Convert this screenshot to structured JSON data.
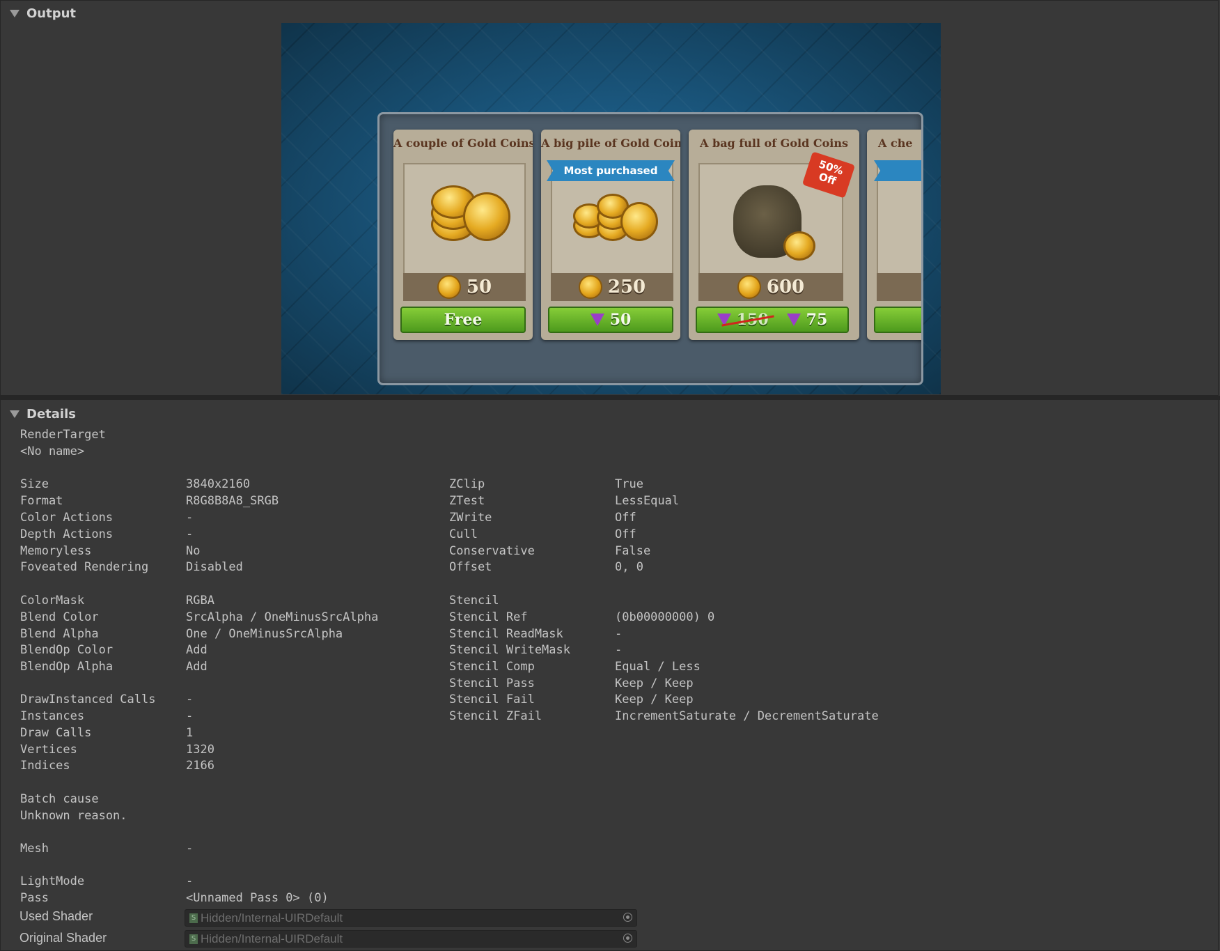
{
  "output_panel": {
    "title": "Output"
  },
  "preview": {
    "cards": [
      {
        "title": "A couple of Gold Coins",
        "amount": "50",
        "button": "Free"
      },
      {
        "title": "A big pile of Gold Coins",
        "ribbon": "Most purchased",
        "amount": "250",
        "button_price": "50"
      },
      {
        "title": "A bag full of Gold Coins",
        "tag": "50% Off",
        "amount": "600",
        "old_price": "150",
        "button_price": "75"
      },
      {
        "title": "A che"
      }
    ]
  },
  "details_panel": {
    "title": "Details",
    "render_target_label": "RenderTarget",
    "render_target_name": "<No name>",
    "left": [
      {
        "label": "Size",
        "value": "3840x2160"
      },
      {
        "label": "Format",
        "value": "R8G8B8A8_SRGB"
      },
      {
        "label": "Color Actions",
        "value": "-"
      },
      {
        "label": "Depth Actions",
        "value": "-"
      },
      {
        "label": "Memoryless",
        "value": "No"
      },
      {
        "label": "Foveated Rendering",
        "value": "Disabled"
      },
      {
        "label": "ColorMask",
        "value": "RGBA"
      },
      {
        "label": "Blend Color",
        "value": "SrcAlpha / OneMinusSrcAlpha"
      },
      {
        "label": "Blend Alpha",
        "value": "One / OneMinusSrcAlpha"
      },
      {
        "label": "BlendOp Color",
        "value": "Add"
      },
      {
        "label": "BlendOp Alpha",
        "value": "Add"
      },
      {
        "label": "DrawInstanced Calls",
        "value": "-"
      },
      {
        "label": "Instances",
        "value": "-"
      },
      {
        "label": "Draw Calls",
        "value": "1"
      },
      {
        "label": "Vertices",
        "value": "1320"
      },
      {
        "label": "Indices",
        "value": "2166"
      }
    ],
    "right": [
      {
        "label": "ZClip",
        "value": "True"
      },
      {
        "label": "ZTest",
        "value": "LessEqual"
      },
      {
        "label": "ZWrite",
        "value": "Off"
      },
      {
        "label": "Cull",
        "value": "Off"
      },
      {
        "label": "Conservative",
        "value": "False"
      },
      {
        "label": "Offset",
        "value": "0, 0"
      },
      {
        "label": "Stencil",
        "value": ""
      },
      {
        "label": "Stencil Ref",
        "value": "(0b00000000) 0"
      },
      {
        "label": "Stencil ReadMask",
        "value": "-"
      },
      {
        "label": "Stencil WriteMask",
        "value": "-"
      },
      {
        "label": "Stencil Comp",
        "value": "Equal / Less"
      },
      {
        "label": "Stencil Pass",
        "value": "Keep / Keep"
      },
      {
        "label": "Stencil Fail",
        "value": "Keep / Keep"
      },
      {
        "label": "Stencil ZFail",
        "value": "IncrementSaturate / DecrementSaturate"
      }
    ],
    "batch_cause_label": "Batch cause",
    "batch_cause_value": "Unknown reason.",
    "mesh_label": "Mesh",
    "mesh_value": "-",
    "lightmode_label": "LightMode",
    "lightmode_value": "-",
    "pass_label": "Pass",
    "pass_value": "<Unnamed Pass 0> (0)",
    "used_shader_label": "Used Shader",
    "used_shader_value": "Hidden/Internal-UIRDefault",
    "original_shader_label": "Original Shader",
    "original_shader_value": "Hidden/Internal-UIRDefault"
  }
}
